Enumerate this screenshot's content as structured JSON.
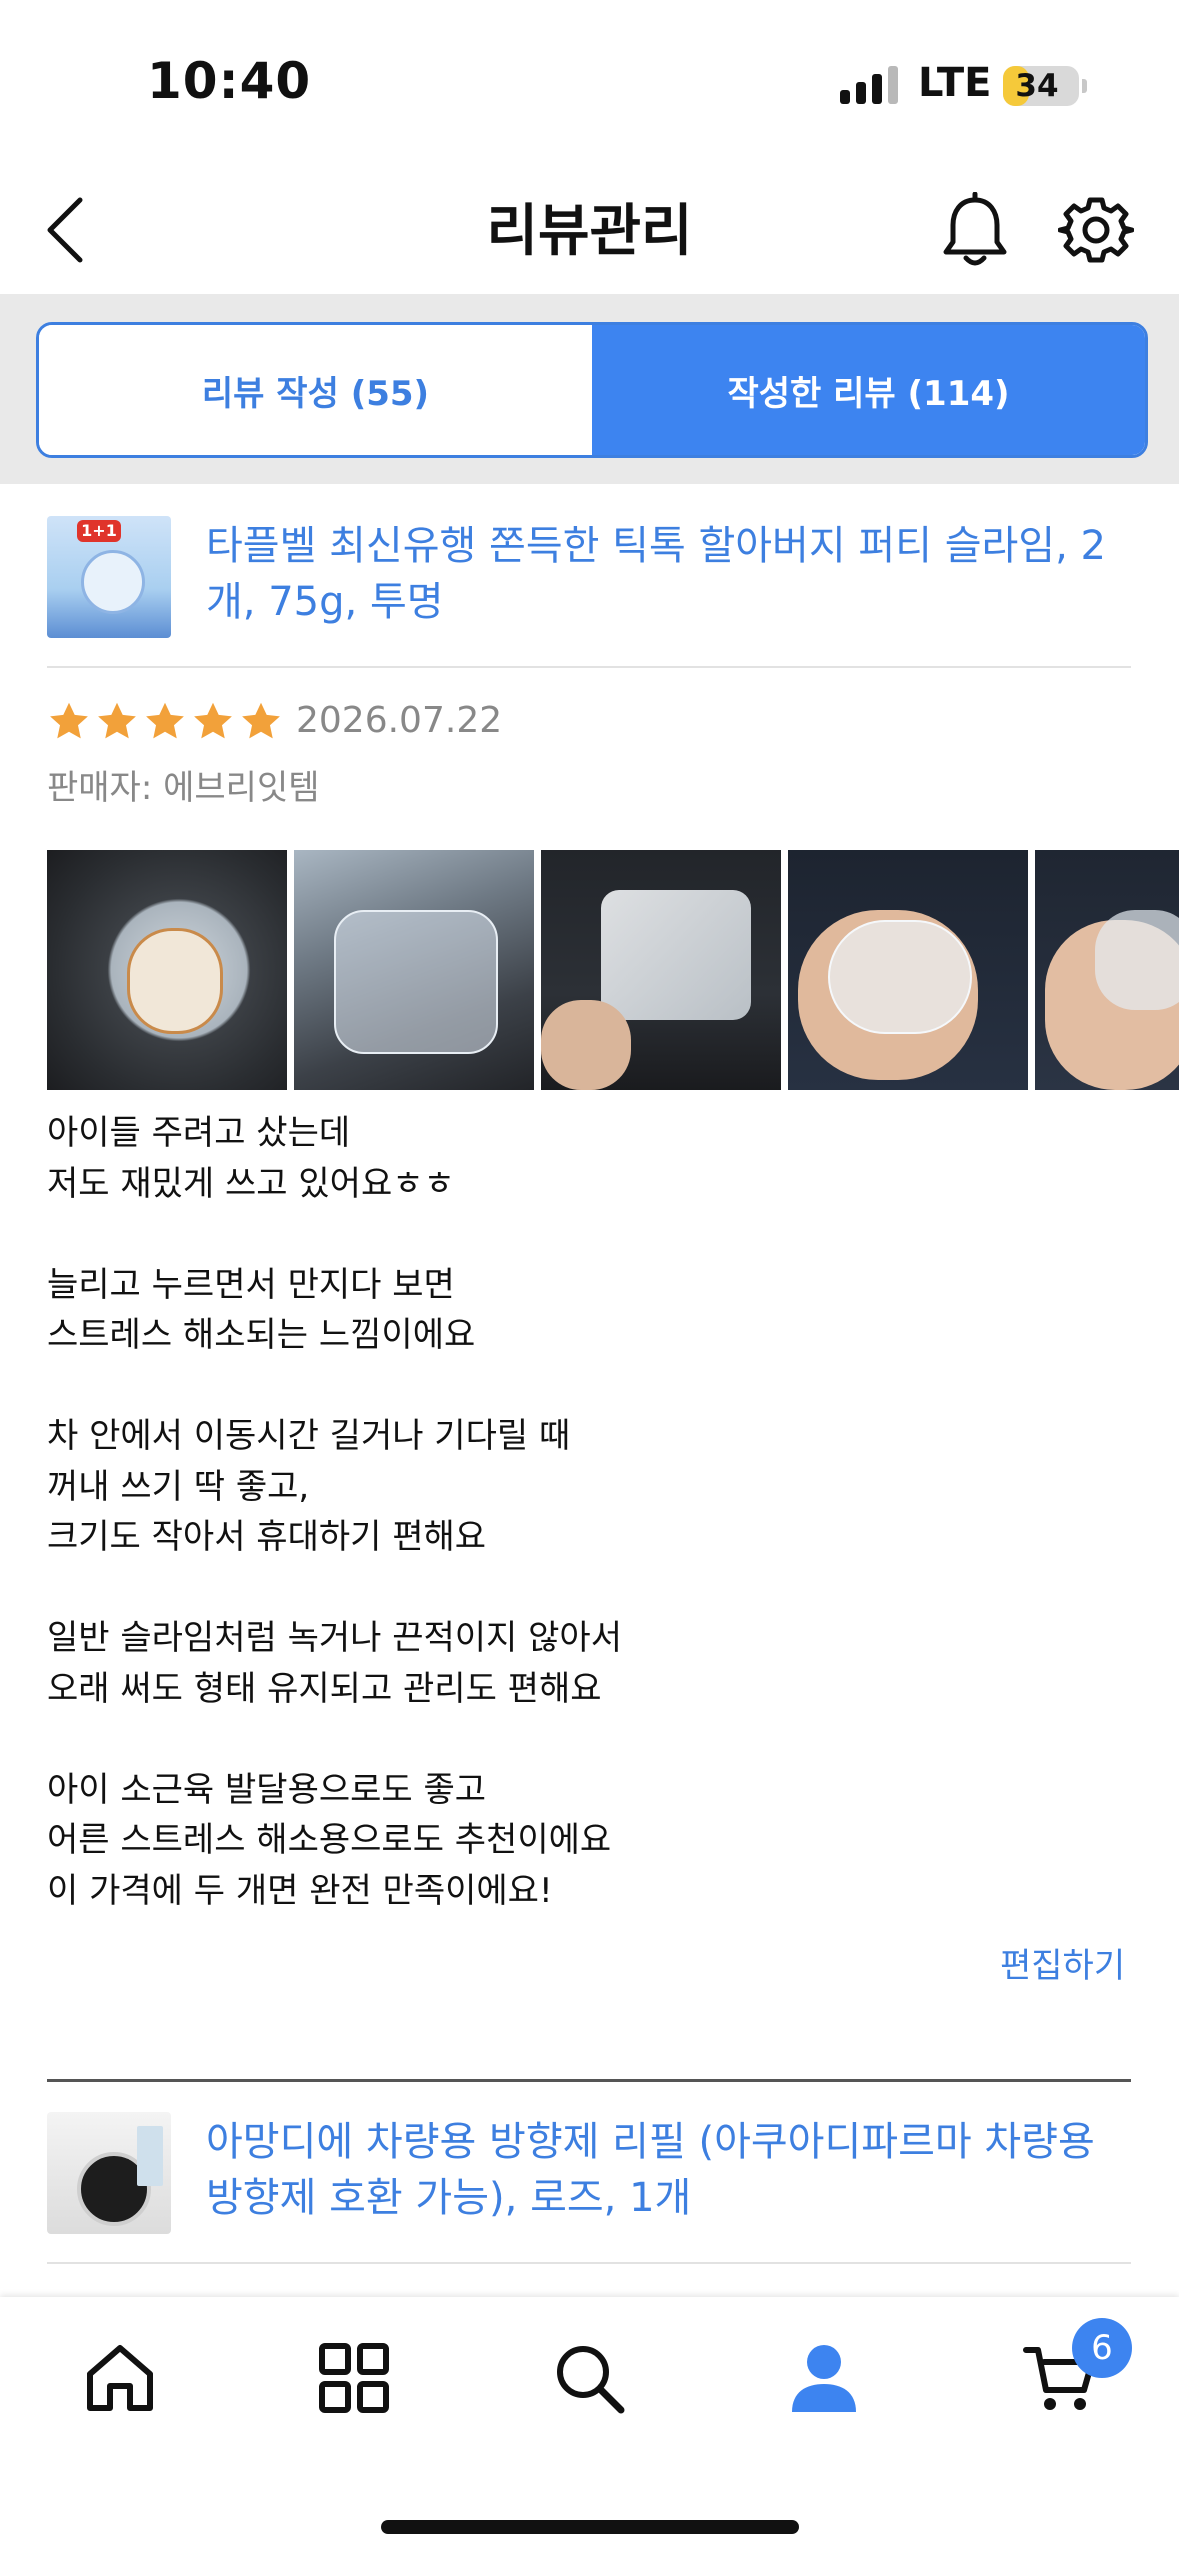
{
  "status_bar": {
    "time": "10:40",
    "network": "LTE",
    "battery": "34",
    "battery_level": 0.34
  },
  "header": {
    "title": "리뷰관리"
  },
  "tabs": [
    {
      "label": "리뷰 작성 (55)",
      "active": false
    },
    {
      "label": "작성한 리뷰 (114)",
      "active": true
    }
  ],
  "reviews": [
    {
      "product_title": "타플벨 최신유행 쫀득한 틱톡 할아버지 퍼티 슬라임, 2개, 75g, 투명",
      "thumb_badge": "1+1",
      "rating": 5,
      "date": "2026.07.22",
      "seller": "판매자: 에브리잇템",
      "photo_count_visible": 5,
      "body": "아이들 주려고 샀는데\n저도 재밌게 쓰고 있어요ㅎㅎ\n\n늘리고 누르면서 만지다 보면\n스트레스 해소되는 느낌이에요\n\n차 안에서 이동시간 길거나 기다릴 때\n꺼내 쓰기 딱 좋고,\n크기도 작아서 휴대하기 편해요\n\n일반 슬라임처럼 녹거나 끈적이지 않아서\n오래 써도 형태 유지되고 관리도 편해요\n\n아이 소근육 발달용으로도 좋고\n어른 스트레스 해소용으로도 추천이에요\n이 가격에 두 개면 완전 만족이에요!",
      "edit_label": "편집하기"
    },
    {
      "product_title": "아망디에 차량용 방향제 리필 (아쿠아디파르마 차량용 방향제 호환 가능), 로즈, 1개"
    }
  ],
  "bottom_nav": {
    "items": [
      "home-icon",
      "categories-icon",
      "search-icon",
      "my-page-icon",
      "cart-icon"
    ],
    "cart_count": "6",
    "active": "my-page-icon"
  },
  "colors": {
    "accent": "#3d84f0",
    "link": "#3d7fe0",
    "star": "#f2a13a"
  }
}
